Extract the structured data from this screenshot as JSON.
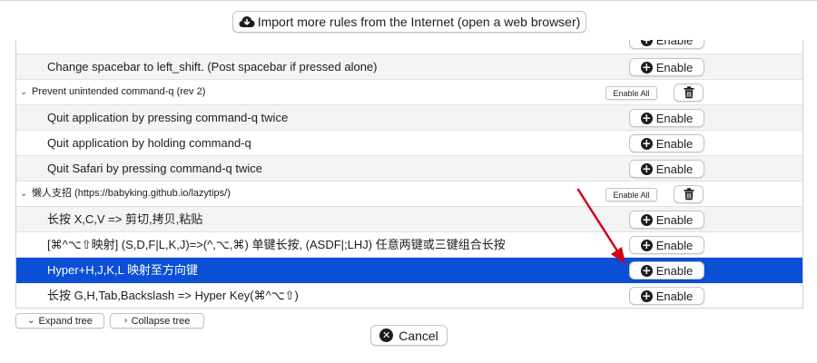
{
  "import_button": {
    "label": "Import more rules from the Internet (open a web browser)",
    "icon": "cloud-download-icon"
  },
  "rules": {
    "enable_label": "Enable",
    "enable_all_label": "Enable All",
    "partial_row": {
      "label": "Change spacebar to left_shift. (Post spacebar if pressed alone)"
    },
    "partial_row_above": {
      "label": ""
    },
    "groups": [
      {
        "title": "Prevent unintended command-q (rev 2)",
        "items": [
          {
            "label": "Quit application by pressing command-q twice"
          },
          {
            "label": "Quit application by holding command-q"
          },
          {
            "label": "Quit Safari by pressing command-q twice"
          }
        ]
      },
      {
        "title": "懒人支招 (https://babyking.github.io/lazytips/)",
        "items": [
          {
            "label": "长按 X,C,V => 剪切,拷贝,粘贴"
          },
          {
            "label": "[⌘^⌥⇧映射] (S,D,F|L,K,J)=>(^,⌥,⌘) 单键长按, (ASDF|;LHJ) 任意两键或三键组合长按"
          },
          {
            "label": "Hyper+H,J,K,L 映射至方向键",
            "selected": true
          },
          {
            "label": "长按 G,H,Tab,Backslash => Hyper Key(⌘^⌥⇧)"
          }
        ]
      }
    ]
  },
  "tree_controls": {
    "expand_label": "Expand tree",
    "collapse_label": "Collapse tree"
  },
  "cancel_button": {
    "label": "Cancel"
  },
  "colors": {
    "selection": "#0a4fd6",
    "annotation_arrow": "#d0021b"
  }
}
